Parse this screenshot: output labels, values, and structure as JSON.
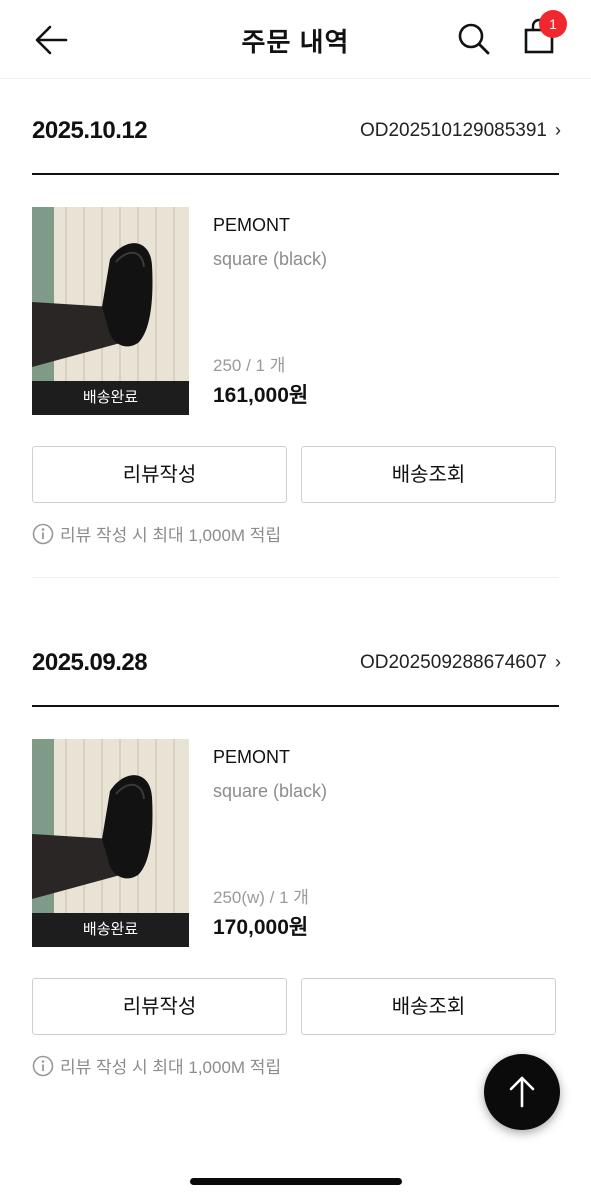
{
  "header": {
    "title": "주문 내역",
    "back_icon": "arrow-left-icon",
    "search_icon": "search-icon",
    "cart_icon": "shopping-bag-icon",
    "cart_badge": "1",
    "badge_color": "#f0282d"
  },
  "orders": [
    {
      "date": "2025.10.12",
      "order_number": "OD202510129085391",
      "chevron": "›",
      "item": {
        "status": "배송완료",
        "brand": "PEMONT",
        "option": "square (black)",
        "size_qty": "250 / 1 개",
        "price": "161,000원"
      },
      "buttons": {
        "review": "리뷰작성",
        "track": "배송조회"
      },
      "notice": "리뷰 작성 시 최대 1,000M 적립"
    },
    {
      "date": "2025.09.28",
      "order_number": "OD202509288674607",
      "chevron": "›",
      "item": {
        "status": "배송완료",
        "brand": "PEMONT",
        "option": "square (black)",
        "size_qty": "250(w) / 1 개",
        "price": "170,000원"
      },
      "buttons": {
        "review": "리뷰작성",
        "track": "배송조회"
      },
      "notice": "리뷰 작성 시 최대 1,000M 적립"
    }
  ],
  "floating": {
    "scroll_top_icon": "arrow-up-icon"
  }
}
